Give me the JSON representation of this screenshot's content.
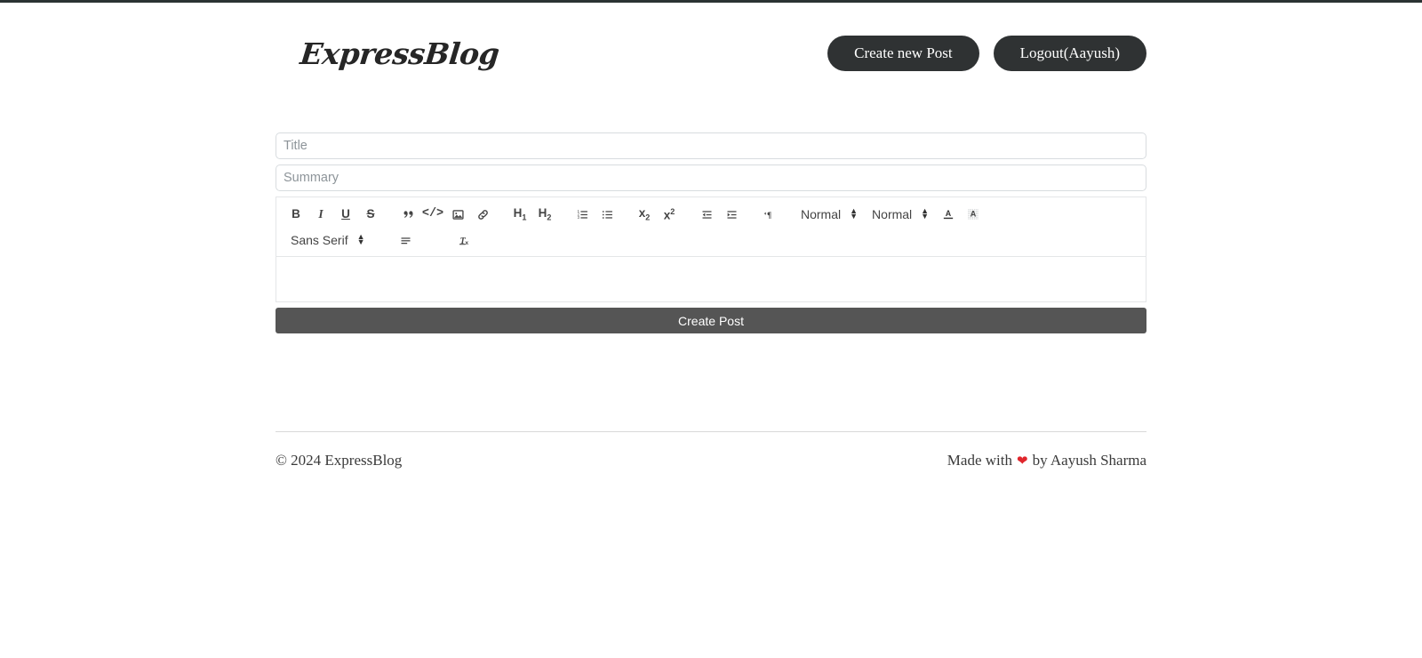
{
  "site": {
    "logo_text": "ExpressBlog"
  },
  "header": {
    "create_post_label": "Create new Post",
    "logout_label": "Logout(Aayush)"
  },
  "form": {
    "title_placeholder": "Title",
    "title_value": "",
    "summary_placeholder": "Summary",
    "summary_value": "",
    "editor_content": "",
    "submit_label": "Create Post"
  },
  "editor_toolbar": {
    "row1": {
      "bold": "B",
      "italic": "I",
      "underline": "U",
      "strike": "S",
      "blockquote": "”",
      "code_block": "</>",
      "image": "image-icon",
      "link": "link-icon",
      "header1": "H1",
      "header2": "H2",
      "ordered_list": "ordered-list-icon",
      "bullet_list": "bullet-list-icon",
      "subscript": "x2",
      "superscript": "x2",
      "outdent": "outdent-icon",
      "indent": "indent-icon",
      "direction": "text-direction-icon",
      "size_value": "Normal",
      "header_value": "Normal",
      "color": "font-color-icon",
      "background": "background-color-icon"
    },
    "row2": {
      "font_value": "Sans Serif",
      "align": "align-icon",
      "clean": "clear-format-icon"
    }
  },
  "footer": {
    "copyright": "© 2024 ExpressBlog",
    "made_with": "Made with",
    "heart": "❤",
    "by": "by Aayush Sharma"
  },
  "colors": {
    "dark_button": "#2f3233",
    "submit_button": "#555555",
    "input_border": "#d8dcdf",
    "toolbar_border": "#e4e6e8",
    "heart_red": "#e0262c"
  }
}
